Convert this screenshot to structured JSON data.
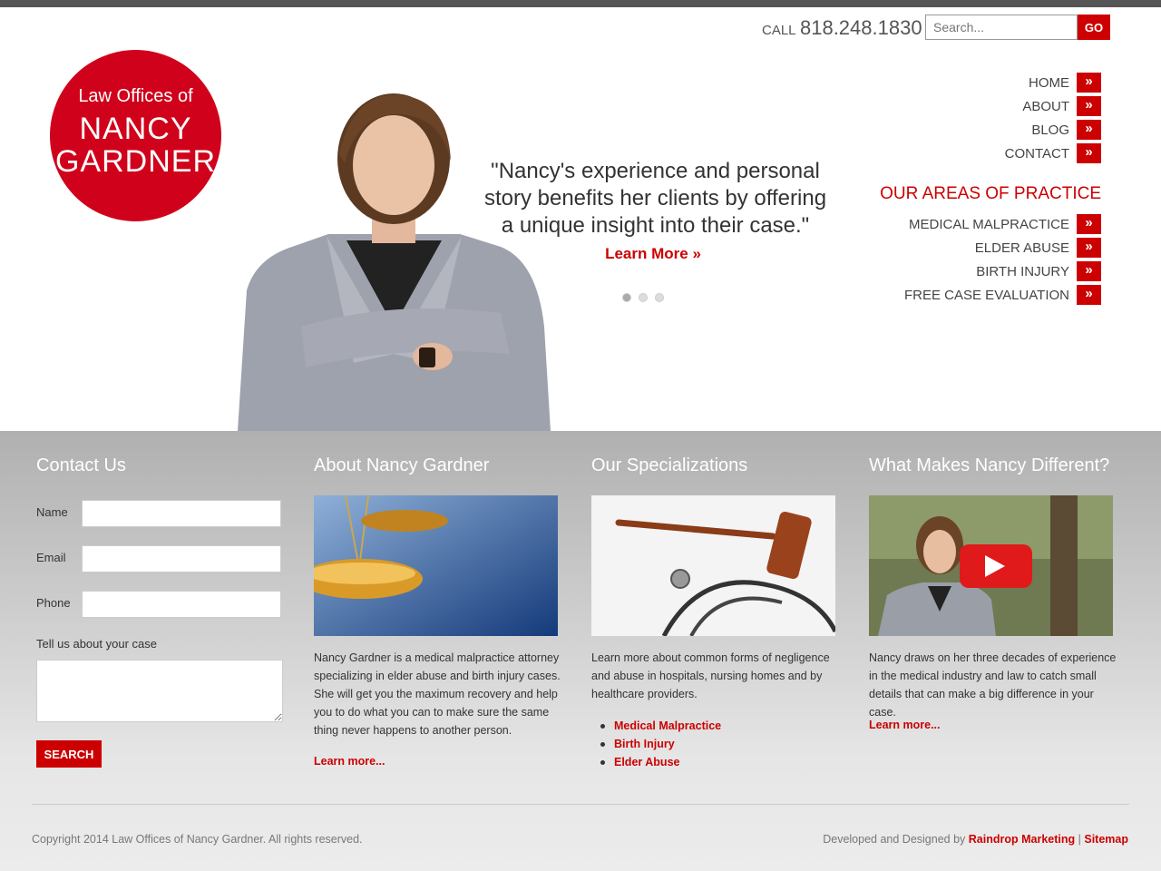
{
  "header": {
    "call_label": "CALL",
    "phone": "818.248.1830",
    "search_placeholder": "Search...",
    "go_label": "GO"
  },
  "logo": {
    "line1": "Law Offices of",
    "line2": "NANCY",
    "line3": "GARDNER"
  },
  "hero": {
    "quote_line1": "\"Nancy's experience and personal",
    "quote_line2": "story benefits her clients by offering",
    "quote_line3": "a unique insight into their case.\"",
    "learn_more": "Learn More »",
    "slide_count": 3,
    "active_slide": 1
  },
  "nav": {
    "items": [
      {
        "label": "HOME"
      },
      {
        "label": "ABOUT"
      },
      {
        "label": "BLOG"
      },
      {
        "label": "CONTACT"
      }
    ],
    "chevron_icon": "double-chevron-right-icon"
  },
  "practice": {
    "title": "OUR AREAS OF PRACTICE",
    "items": [
      {
        "label": "MEDICAL MALPRACTICE"
      },
      {
        "label": "ELDER ABUSE"
      },
      {
        "label": "BIRTH INJURY"
      },
      {
        "label": "FREE CASE EVALUATION"
      }
    ]
  },
  "contact": {
    "title": "Contact Us",
    "name_label": "Name",
    "email_label": "Email",
    "phone_label": "Phone",
    "case_label": "Tell us about your case",
    "submit_label": "SEARCH"
  },
  "about": {
    "title": "About Nancy Gardner",
    "text": "Nancy Gardner is a medical malpractice attorney specializing in elder abuse and birth injury cases. She will get you the maximum recovery and help you to do what you can to make sure the same thing never happens to another person.",
    "link": "Learn more..."
  },
  "specializations": {
    "title": "Our Specializations",
    "text": "Learn more about common forms of negligence and abuse in hospitals, nursing homes and by healthcare providers.",
    "items": [
      "Medical Malpractice",
      "Birth Injury",
      "Elder Abuse"
    ]
  },
  "different": {
    "title": "What Makes Nancy Different?",
    "text": "Nancy draws on her three decades of experience in the medical industry and law to catch small details that can make a big difference in your case.",
    "link": "Learn more..."
  },
  "footer": {
    "copyright": "Copyright 2014 Law Offices of Nancy Gardner. All rights reserved.",
    "dev_prefix": "Developed and Designed by",
    "dev_link": "Raindrop Marketing",
    "separator": "|",
    "sitemap": "Sitemap"
  },
  "colors": {
    "accent": "#cc0000",
    "logo": "#d0021b",
    "topbar": "#555555"
  }
}
